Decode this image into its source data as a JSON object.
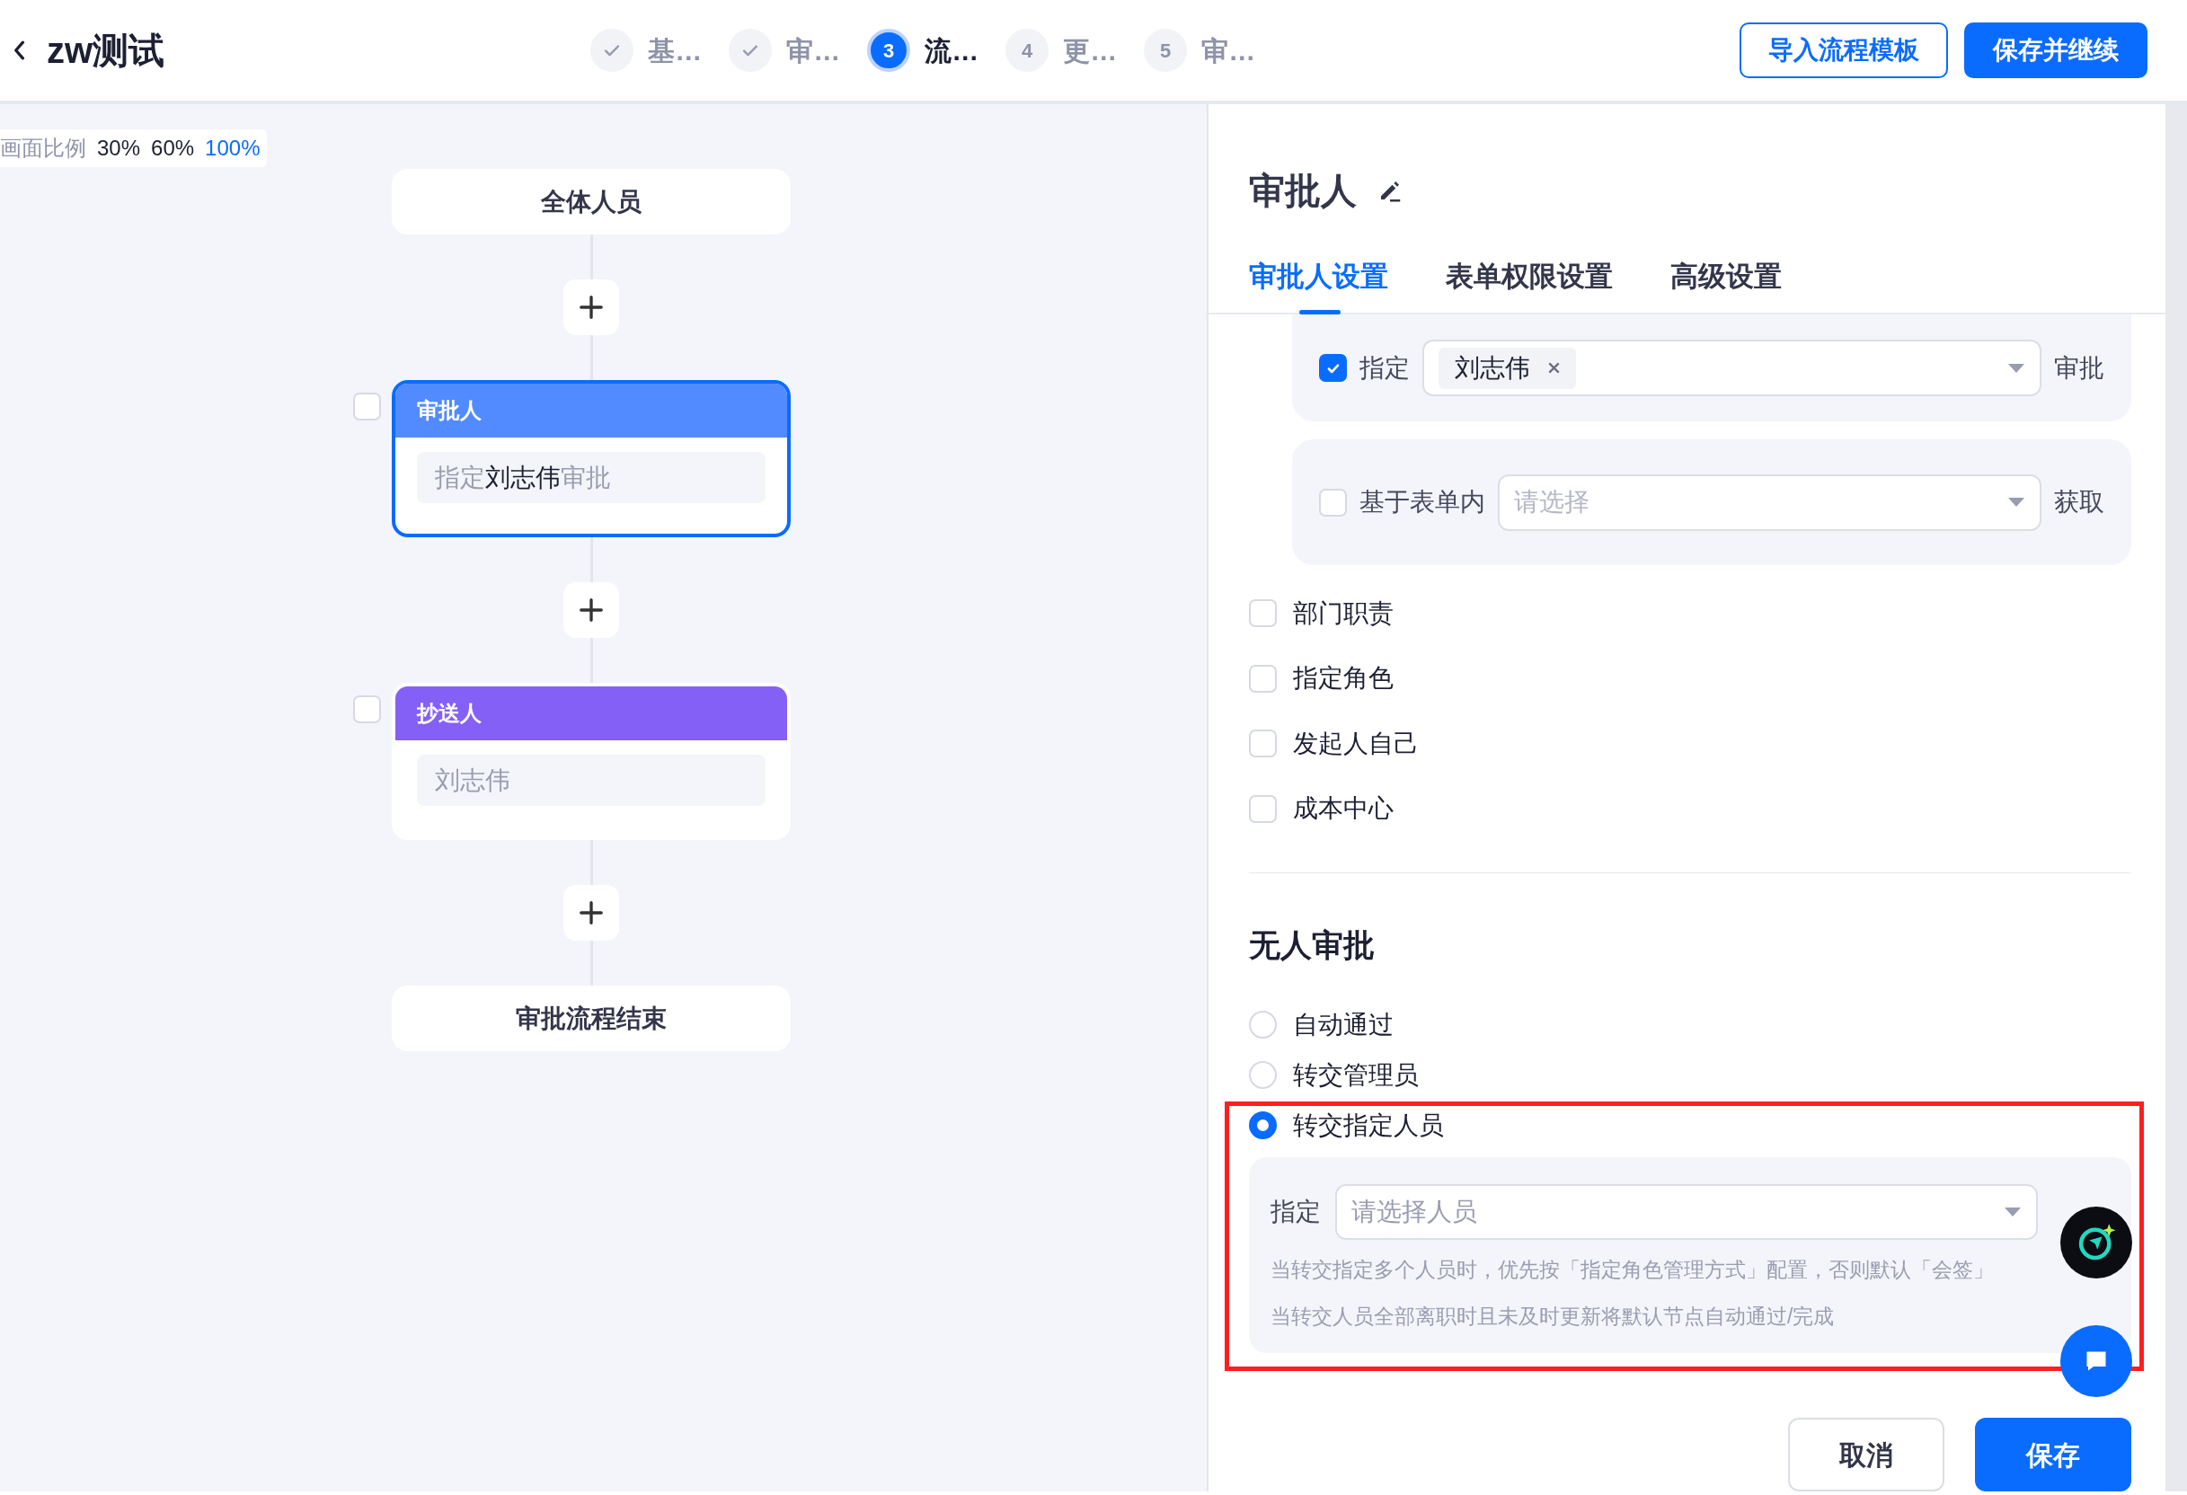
{
  "header": {
    "title": "zw测试"
  },
  "steps": [
    {
      "done": true,
      "selected": false,
      "label": "基…"
    },
    {
      "done": true,
      "selected": false,
      "label": "审…"
    },
    {
      "done": false,
      "selected": true,
      "number": "3",
      "label": "流…"
    },
    {
      "done": false,
      "selected": false,
      "number": "4",
      "label": "更…"
    },
    {
      "done": false,
      "selected": false,
      "number": "5",
      "label": "审…"
    }
  ],
  "actions": [
    {
      "kind": "outline",
      "label": "导入流程模板"
    },
    {
      "kind": "primary",
      "label": "保存并继续"
    }
  ],
  "zoom": {
    "label": "画面比例",
    "options": [
      {
        "label": "30%",
        "selected": false
      },
      {
        "label": "60%",
        "selected": false
      },
      {
        "label": "100%",
        "selected": true
      }
    ]
  },
  "flow": {
    "nodes": [
      {
        "kind": "terminal",
        "label": "全体人员"
      },
      {
        "kind": "approver",
        "title": "审批人",
        "checked": false,
        "selected": true,
        "pre": "指定",
        "name": "刘志伟",
        "post": "审批"
      },
      {
        "kind": "cc",
        "title": "抄送人",
        "checked": false,
        "selected": false,
        "summary": "刘志伟"
      },
      {
        "kind": "terminal",
        "label": "审批流程结束"
      }
    ]
  },
  "panel": {
    "title": "审批人",
    "tabs": [
      {
        "label": "审批人设置",
        "selected": true
      },
      {
        "label": "表单权限设置",
        "selected": false
      },
      {
        "label": "高级设置",
        "selected": false
      }
    ],
    "options": [
      {
        "kind": "tags",
        "checked": true,
        "label": "指定",
        "tags": [
          "刘志伟"
        ],
        "suffix": "审批"
      },
      {
        "kind": "select",
        "checked": false,
        "label": "基于表单内",
        "placeholder": "请选择",
        "suffix": "获取"
      },
      {
        "kind": "plain",
        "checked": false,
        "label": "部门职责"
      },
      {
        "kind": "plain",
        "checked": false,
        "label": "指定角色"
      },
      {
        "kind": "plain",
        "checked": false,
        "label": "发起人自己"
      },
      {
        "kind": "plain",
        "checked": false,
        "label": "成本中心"
      }
    ],
    "no_approver": {
      "title": "无人审批",
      "options": [
        {
          "label": "自动通过",
          "selected": false
        },
        {
          "label": "转交管理员",
          "selected": false
        },
        {
          "label": "转交指定人员",
          "selected": true
        }
      ],
      "transfer": {
        "label": "指定",
        "placeholder": "请选择人员",
        "notes": [
          "当转交指定多个人员时，优先按「指定角色管理方式」配置，否则默认「会签」",
          "当转交人员全部离职时且未及时更新将默认节点自动通过/完成"
        ]
      }
    },
    "buttons": [
      {
        "kind": "secondary",
        "label": "取消"
      },
      {
        "kind": "primary",
        "label": "保存"
      }
    ]
  }
}
